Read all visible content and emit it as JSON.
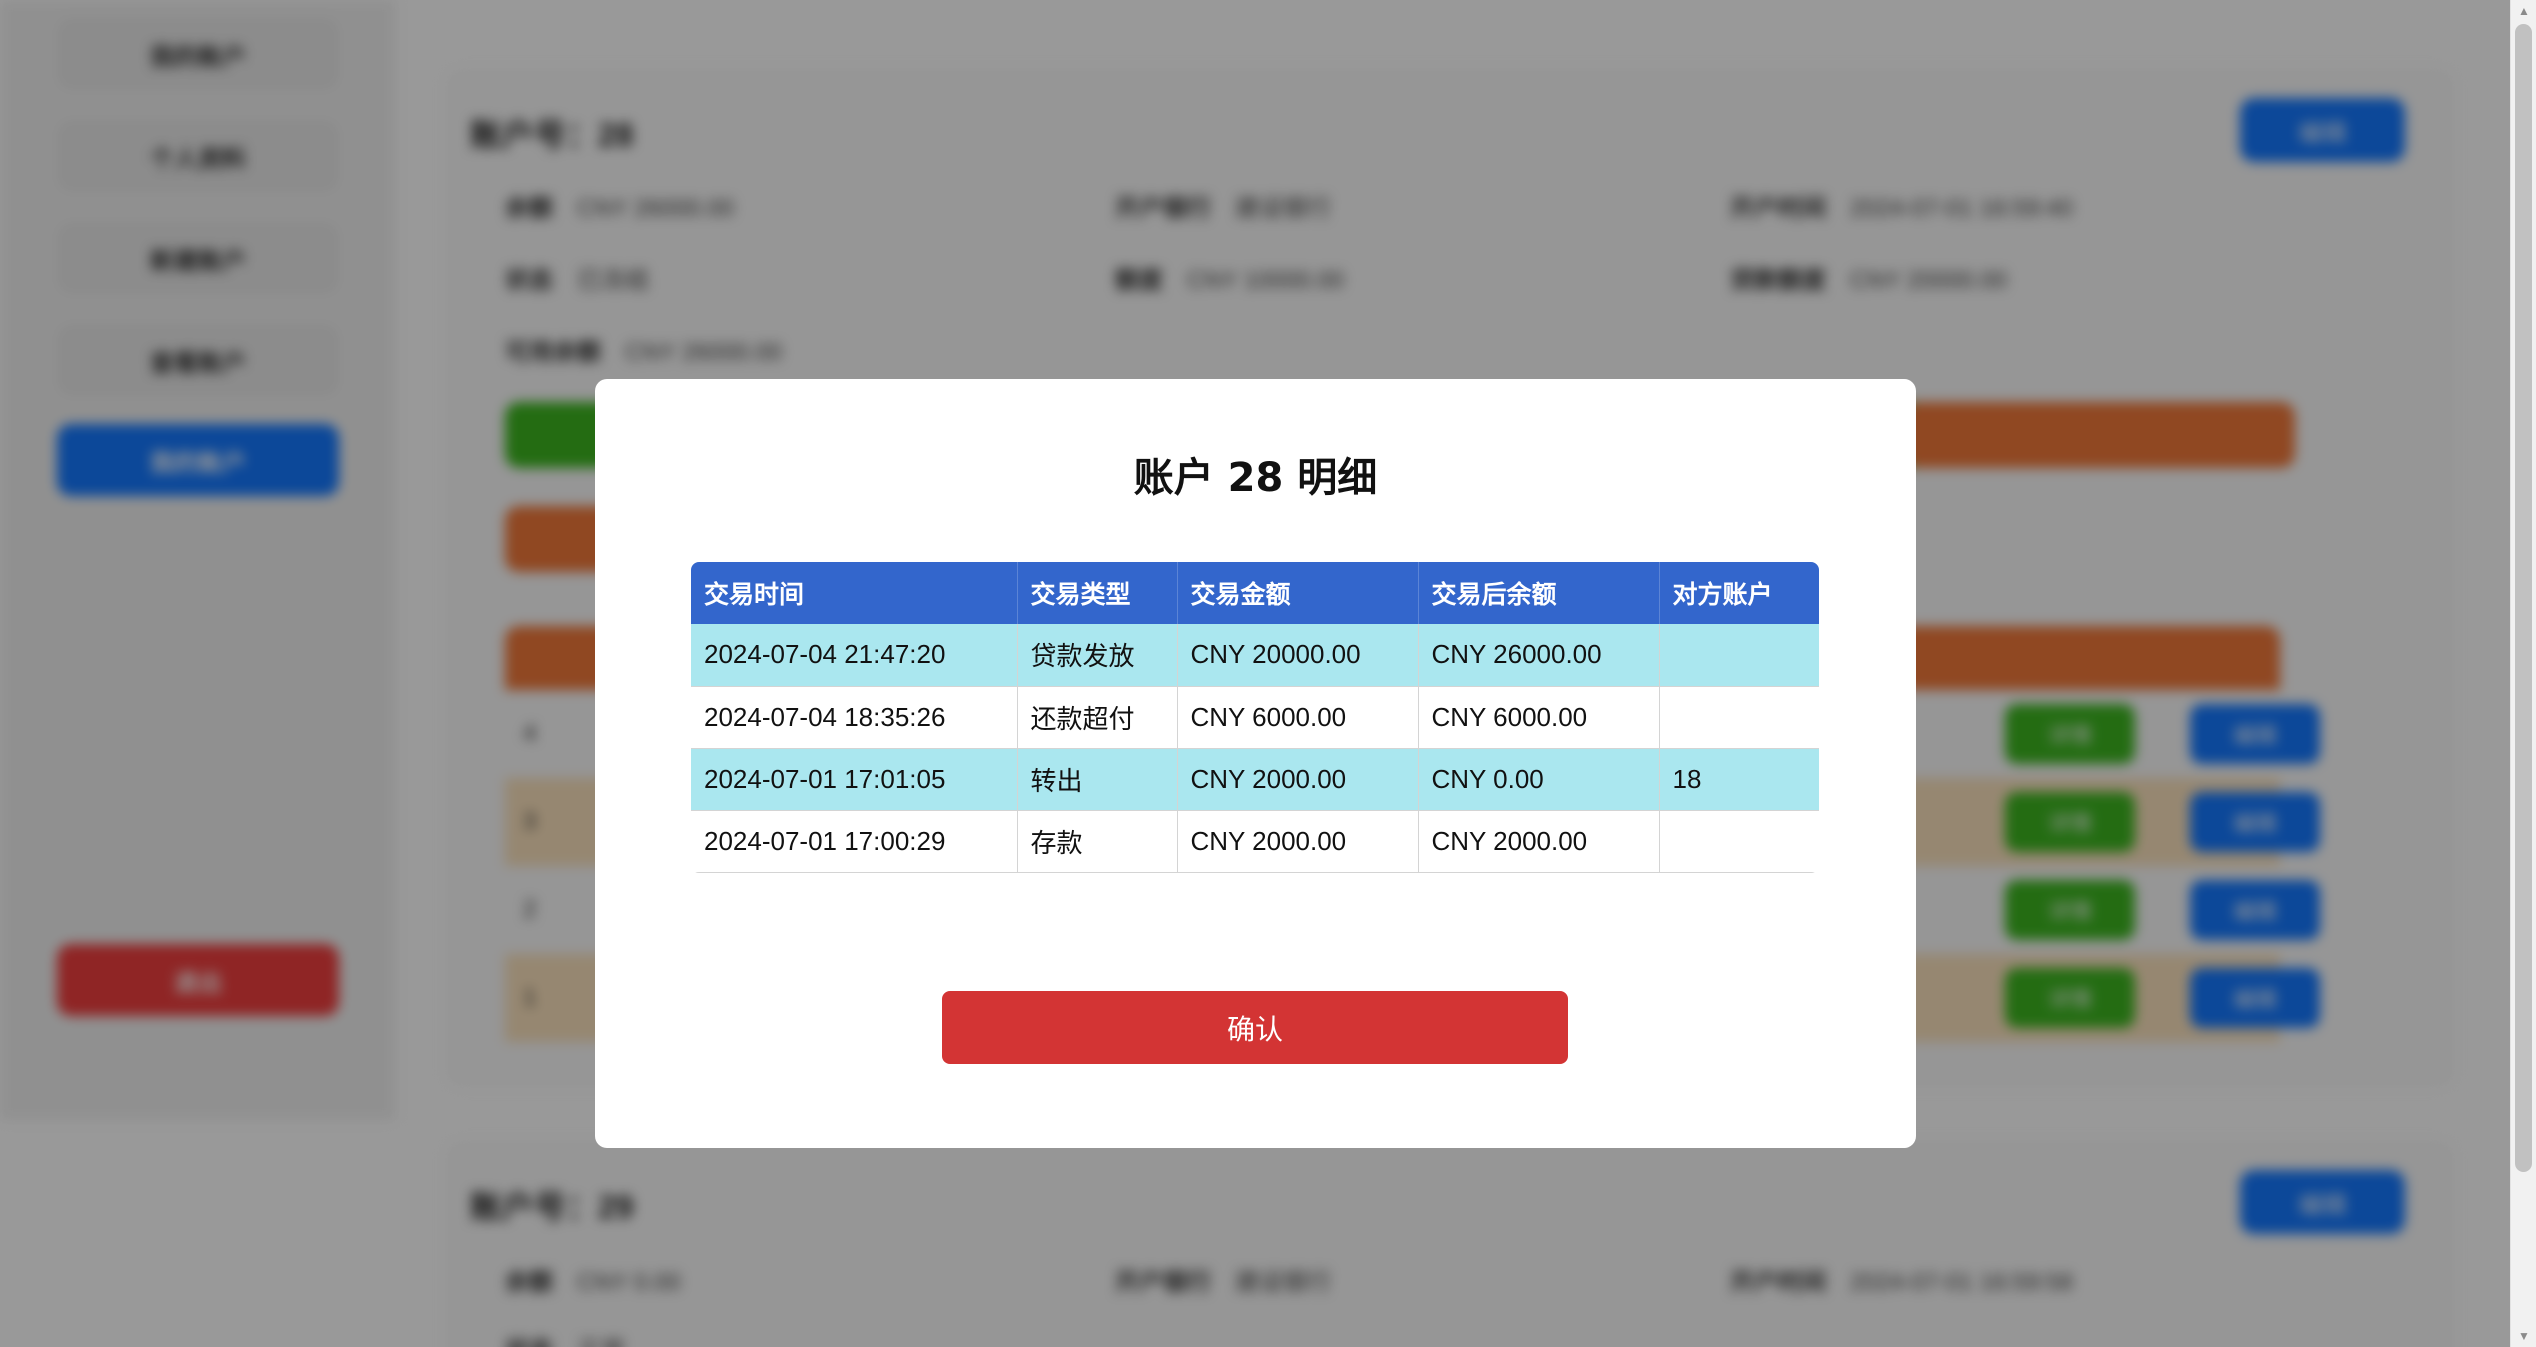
{
  "background": {
    "sidebar": {
      "items": [
        {
          "label": "我的账户"
        },
        {
          "label": "个人资料"
        },
        {
          "label": "新建账户"
        },
        {
          "label": "查看账户"
        },
        {
          "label": "我的账户"
        }
      ],
      "logout_label": "退出"
    },
    "accounts": [
      {
        "title": "账户号：28",
        "edit_label": "编辑",
        "fields": [
          {
            "label": "余额",
            "value": "CNY 26000.00"
          },
          {
            "label": "开户银行",
            "value": "建设银行"
          },
          {
            "label": "开户时间",
            "value": "2024-07-01 16:59:40"
          },
          {
            "label": "状态",
            "value": "已冻结"
          },
          {
            "label": "额度",
            "value": "CNY 10000.00"
          },
          {
            "label": "贷款额度",
            "value": "CNY 20000.00"
          },
          {
            "label": "可用余额",
            "value": "CNY 26000.00"
          }
        ]
      },
      {
        "title": "账户号：29",
        "edit_label": "编辑",
        "fields": [
          {
            "label": "余额",
            "value": "CNY 0.00"
          },
          {
            "label": "开户银行",
            "value": "建设银行"
          },
          {
            "label": "开户时间",
            "value": "2024-07-01 16:59:58"
          },
          {
            "label": "状态",
            "value": "正常"
          }
        ]
      }
    ],
    "row_numbers": [
      "4",
      "3",
      "2",
      "1"
    ],
    "row_button_labels": {
      "green": "详情",
      "blue": "编辑"
    }
  },
  "modal": {
    "title": "账户 28 明细",
    "columns": [
      "交易时间",
      "交易类型",
      "交易金额",
      "交易后余额",
      "对方账户"
    ],
    "rows": [
      [
        "2024-07-04 21:47:20",
        "贷款发放",
        "CNY 20000.00",
        "CNY 26000.00",
        ""
      ],
      [
        "2024-07-04 18:35:26",
        "还款超付",
        "CNY 6000.00",
        "CNY 6000.00",
        ""
      ],
      [
        "2024-07-01 17:01:05",
        "转出",
        "CNY 2000.00",
        "CNY 0.00",
        "18"
      ],
      [
        "2024-07-01 17:00:29",
        "存款",
        "CNY 2000.00",
        "CNY 2000.00",
        ""
      ]
    ],
    "confirm_label": "确认"
  },
  "colors": {
    "header_blue": "#3366cc",
    "highlight_row": "#aae7ef",
    "confirm_red": "#d33434"
  }
}
